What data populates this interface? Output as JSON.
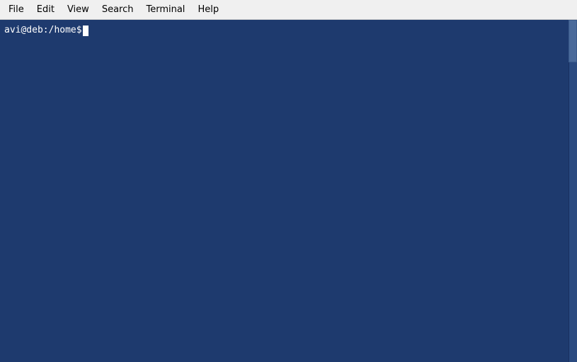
{
  "menubar": {
    "items": [
      {
        "id": "file",
        "label": "File"
      },
      {
        "id": "edit",
        "label": "Edit"
      },
      {
        "id": "view",
        "label": "View"
      },
      {
        "id": "search",
        "label": "Search"
      },
      {
        "id": "terminal",
        "label": "Terminal"
      },
      {
        "id": "help",
        "label": "Help"
      }
    ]
  },
  "terminal": {
    "prompt": "avi@deb:/home$",
    "background_color": "#1e3a6e"
  }
}
